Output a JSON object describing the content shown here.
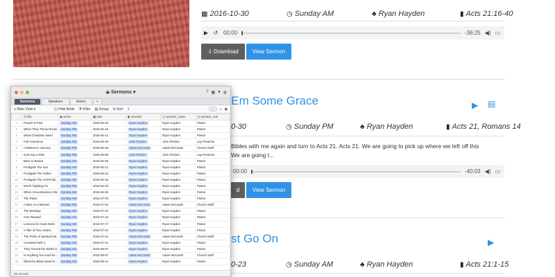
{
  "sermons": [
    {
      "title": "",
      "date": "2016-10-30",
      "service": "Sunday AM",
      "speaker": "Ryan Hayden",
      "passage": "Acts 21:16-40",
      "player": {
        "current": "00:00",
        "remaining": "-36:25"
      },
      "download_label": "Download",
      "view_label": "View Sermon"
    },
    {
      "title": "'Em Some Grace",
      "date": "0-30",
      "service": "Sunday PM",
      "speaker": "Ryan Hayden",
      "passage": "Acts 21, Romans 14",
      "excerpt_line1": "Bibles with me again and turn to Acts 21. Acts 21. We are going to pick up where we left off this",
      "excerpt_line2": "We are going t...",
      "player": {
        "current": "00:00",
        "remaining": "-40:03"
      },
      "download_label": "d",
      "view_label": "View Sermon"
    },
    {
      "title": "st Go On",
      "date": "0-23",
      "service": "Sunday AM",
      "speaker": "Ryan Hayden",
      "passage": "Acts 21:1-15"
    }
  ],
  "icons": {
    "calendar": "calendar-icon",
    "clock": "clock-icon",
    "speaker": "user-icon",
    "book": "bible-icon",
    "play": "play-icon",
    "document": "document-icon",
    "accent": "#2f92e6",
    "download_button_color": "#5f5f5f"
  },
  "airtable": {
    "title": "Sermons",
    "tabs": [
      "Sermons",
      "Speakers",
      "Series",
      "+"
    ],
    "view_name": "Main View",
    "tools": [
      "Hide fields",
      "Filter",
      "Group",
      "Sort"
    ],
    "columns": [
      "title",
      "series",
      "date",
      "speaker",
      "speaker_name",
      "speaker_role"
    ],
    "rows": [
      [
        "Preach It Paul",
        "Sunday AM",
        "2016-05-15",
        "Ryan Hayden",
        "Ryan Hayden",
        "Pastor"
      ],
      [
        "When They Throw Rocks",
        "Sunday PM",
        "2016-05-15",
        "Ryan Hayden",
        "Ryan Hayden",
        "Pastor"
      ],
      [
        "What Christians Need",
        "Sunday PM",
        "2016-05-22",
        "Ryan Hayden",
        "Ryan Hayden",
        "Pastor"
      ],
      [
        "Full Assurance",
        "Sunday PM",
        "2016-05-29",
        "John Rincker",
        "John Rincker",
        "Lay Preacher"
      ],
      [
        "A Believer's Journey",
        "Sunday PM",
        "2016-05-29",
        "Adam McCaslin",
        "Adam McCaslin",
        "Church Staff"
      ],
      [
        "God Has a Plan",
        "Sunday PM",
        "2016-06-05",
        "John Rincker",
        "John Rincker",
        "Lay Preacher"
      ],
      [
        "Back to Basics",
        "Sunday AM",
        "2016-06-05",
        "Ryan Hayden",
        "Ryan Hayden",
        "Pastor"
      ],
      [
        "Prodigals The Son",
        "Sunday AM",
        "2016-06-12",
        "Ryan Hayden",
        "Ryan Hayden",
        "Pastor"
      ],
      [
        "Prodigals The Father",
        "Sunday PM",
        "2016-06-12",
        "Ryan Hayden",
        "Ryan Hayden",
        "Pastor"
      ],
      [
        "Prodigals The Anti-Prodi...",
        "Sunday AM",
        "2016-06-19",
        "Ryan Hayden",
        "Ryan Hayden",
        "Pastor"
      ],
      [
        "Worth Fighting For",
        "Sunday PM",
        "2016-06-19",
        "Ryan Hayden",
        "Ryan Hayden",
        "Pastor"
      ],
      [
        "When Circumstances Stink",
        "Sunday AM",
        "2016-06-26",
        "Ryan Hayden",
        "Ryan Hayden",
        "Pastor"
      ],
      [
        "The Rules",
        "Sunday AM",
        "2016-07-03",
        "Ryan Hayden",
        "Ryan Hayden",
        "Pastor"
      ],
      [
        "A Man on a Mission",
        "Sunday PM",
        "2016-07-03",
        "Adam McCaslin",
        "Adam McCaslin",
        "Church Staff"
      ],
      [
        "The Breakup",
        "Sunday AM",
        "2016-07-10",
        "Ryan Hayden",
        "Ryan Hayden",
        "Pastor"
      ],
      [
        "Your Reward",
        "Sunday AM",
        "2016-07-10",
        "Ryan Hayden",
        "Ryan Hayden",
        "Pastor"
      ],
      [
        "Lessons for Gods Work",
        "Sunday AM",
        "2016-07-17",
        "Ryan Hayden",
        "Ryan Hayden",
        "Pastor"
      ],
      [
        "A Tale of Two Letters",
        "Sunday PM",
        "2016-07-24",
        "Ryan Hayden",
        "Ryan Hayden",
        "Pastor"
      ],
      [
        "The Perils of Spiritual Str...",
        "Sunday PM",
        "2016-07-24",
        "Adam McCaslin",
        "Adam McCaslin",
        "Church Staff"
      ],
      [
        "Constant Faith 2",
        "Sunday AM",
        "2016-07-31",
        "Ryan Hayden",
        "Ryan Hayden",
        "Pastor"
      ],
      [
        "They Turned the World U...",
        "Sunday AM",
        "2016-08-07",
        "Ryan Hayden",
        "Ryan Hayden",
        "Pastor"
      ],
      [
        "Is Anything Too Hard for ...",
        "Sunday PM",
        "2016-08-07",
        "Adam McCaslin",
        "Adam McCaslin",
        "Church Staff"
      ],
      [
        "What the Bibes Need to ...",
        "Sunday AM",
        "2016-08-14",
        "Ryan Hayden",
        "Ryan Hayden",
        "Pastor"
      ]
    ],
    "footer": "69 records"
  }
}
